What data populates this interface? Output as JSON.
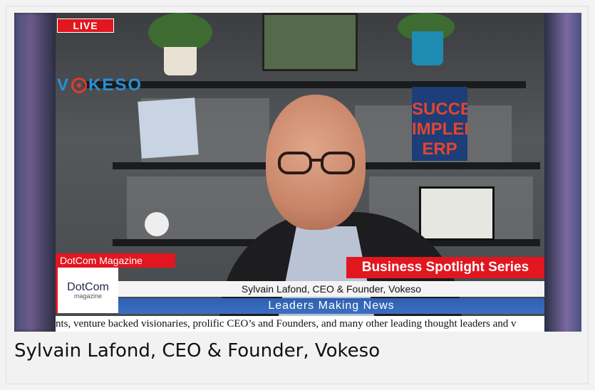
{
  "overlay": {
    "live_label": "LIVE",
    "brand_logo_prefix": "V",
    "brand_logo_suffix": "KESO",
    "channel_tag": "DotCom Magazine",
    "logo_main": "DotCom",
    "logo_sub": "magazine",
    "series_title": "Business Spotlight Series",
    "guest_line": "Sylvain Lafond, CEO & Founder, Vokeso",
    "leaders_line": "Leaders Making News",
    "ticker_text": "nts,    venture backed visionaries, prolific CEO’s and Founders, and many other leading thought leaders and v"
  },
  "scene": {
    "book_title": "SUCCESSFULLY IMPLEMENTING ERP"
  },
  "caption": {
    "text": "Sylvain Lafond, CEO & Founder, Vokeso"
  },
  "colors": {
    "accent_red": "#e2161f",
    "bar_blue": "#3b6fc0",
    "logo_blue": "#2a8fd6"
  }
}
